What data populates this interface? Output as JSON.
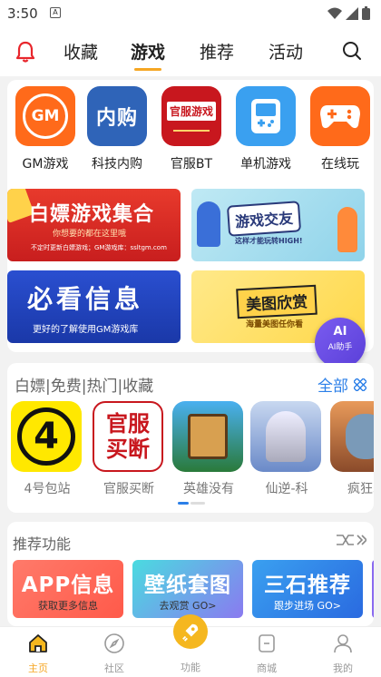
{
  "status": {
    "time": "3:50",
    "notif": "A"
  },
  "topnav": {
    "tabs": [
      "收藏",
      "游戏",
      "推荐",
      "活动"
    ],
    "active_index": 1
  },
  "apps": [
    {
      "label": "GM游戏",
      "icon_text": "GM",
      "color": "#ff6a1a"
    },
    {
      "label": "科技内购",
      "icon_text": "内购",
      "color": "#2f64b8"
    },
    {
      "label": "官服BT",
      "icon_text": "官服游戏",
      "color": "#c8171e"
    },
    {
      "label": "单机游戏",
      "icon_text": "",
      "color": "#3aa0f0"
    },
    {
      "label": "在线玩",
      "icon_text": "",
      "color": "#ff6a1a"
    }
  ],
  "banners": {
    "b1": {
      "title": "白嫖游戏集合",
      "sub": "你想要的都在这里哦",
      "foot": "不定时更新白嫖游戏；GM游戏库：ssltgm.com"
    },
    "b2": {
      "title": "游戏交友",
      "sub": "这样才能玩转HIGH!"
    },
    "b3": {
      "title": "必看信息",
      "sub": "更好的了解使用GM游戏库"
    },
    "b4": {
      "title": "美图欣赏",
      "sub": "海量美图任你看"
    }
  },
  "ai": {
    "circle": "AI",
    "label": "AI助手"
  },
  "section2": {
    "title": "白嫖|免费|热门|收藏",
    "more": "全部",
    "games": [
      {
        "label": "4号包站",
        "icon_text": "4"
      },
      {
        "label": "官服买断",
        "icon_text": "官服买断"
      },
      {
        "label": "英雄没有",
        "icon_text": ""
      },
      {
        "label": "仙逆-科",
        "icon_text": ""
      },
      {
        "label": "疯狂水",
        "icon_text": ""
      }
    ]
  },
  "section3": {
    "title": "推荐功能",
    "items": [
      {
        "title": "APP信息",
        "sub": "获取更多信息",
        "color": "#ff6a5a"
      },
      {
        "title": "壁纸套图",
        "sub": "去观赏 GO>",
        "color": "#3dcdd8"
      },
      {
        "title": "三石推荐",
        "sub": "跟步进场 GO>",
        "color": "#3a9af0"
      }
    ]
  },
  "bottom": {
    "items": [
      "主页",
      "社区",
      "功能",
      "商城",
      "我的"
    ],
    "active_index": 0
  }
}
